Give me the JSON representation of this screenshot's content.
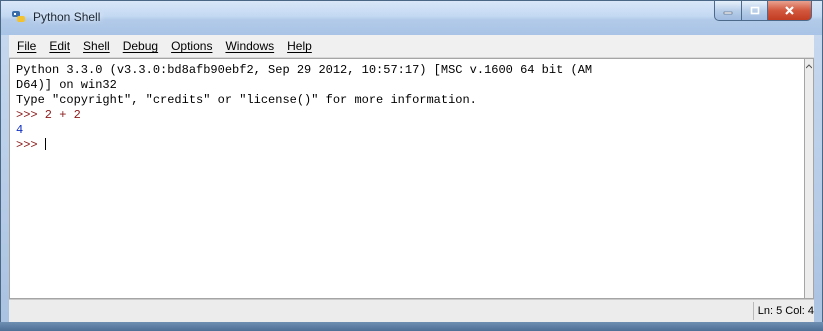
{
  "window": {
    "title": "Python Shell",
    "accent": "#a8c3e6"
  },
  "menu": [
    "File",
    "Edit",
    "Shell",
    "Debug",
    "Options",
    "Windows",
    "Help"
  ],
  "shell": {
    "lines": [
      {
        "text": "Python 3.3.0 (v3.3.0:bd8afb90ebf2, Sep 29 2012, 10:57:17) [MSC v.1600 64 bit (AM",
        "kind": "out"
      },
      {
        "text": "D64)] on win32",
        "kind": "out"
      },
      {
        "text": "Type \"copyright\", \"credits\" or \"license()\" for more information.",
        "kind": "out"
      },
      {
        "text": ">>> 2 + 2",
        "kind": "prompt"
      },
      {
        "text": "4",
        "kind": "val"
      },
      {
        "text": ">>> ",
        "kind": "prompt"
      }
    ],
    "colors": {
      "prompt": "#8b1a1a",
      "result": "#1030c0"
    }
  },
  "status": {
    "position": "Ln: 5 Col: 4"
  },
  "icons": {
    "app": "python-idle-icon",
    "minimize": "minimize-icon",
    "maximize": "maximize-icon",
    "close": "close-icon"
  }
}
